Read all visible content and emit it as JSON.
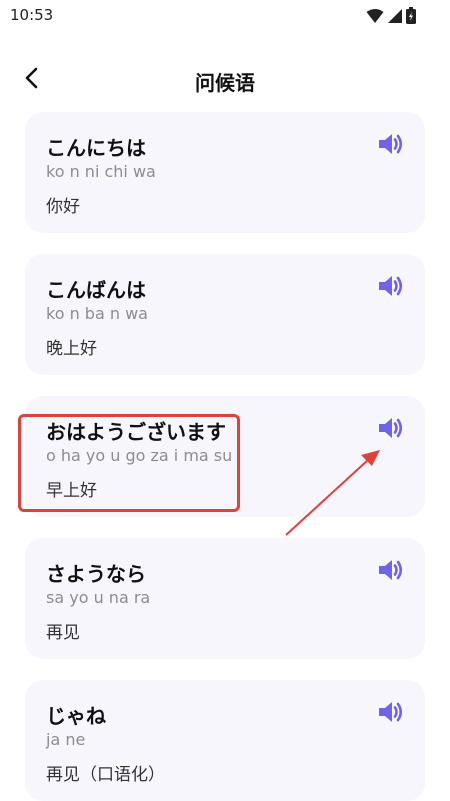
{
  "status": {
    "time": "10:53"
  },
  "header": {
    "title": "问候语"
  },
  "colors": {
    "accent": "#6f63e8",
    "card_bg": "#f7f6fd",
    "annotation": "#e0413a"
  },
  "phrases": [
    {
      "japanese": "こんにちは",
      "romaji": "ko n ni chi wa",
      "chinese": "你好"
    },
    {
      "japanese": "こんばんは",
      "romaji": "ko n ba n wa",
      "chinese": "晚上好"
    },
    {
      "japanese": "おはようございます",
      "romaji": "o ha yo u go za i ma su",
      "chinese": "早上好"
    },
    {
      "japanese": "さようなら",
      "romaji": "sa yo u na ra",
      "chinese": "再见"
    },
    {
      "japanese": "じゃね",
      "romaji": "ja ne",
      "chinese": "再见（口语化）"
    }
  ],
  "icons": {
    "back": "chevron-left-icon",
    "speaker": "speaker-icon",
    "wifi": "wifi-icon",
    "signal": "signal-icon",
    "battery": "battery-icon"
  }
}
